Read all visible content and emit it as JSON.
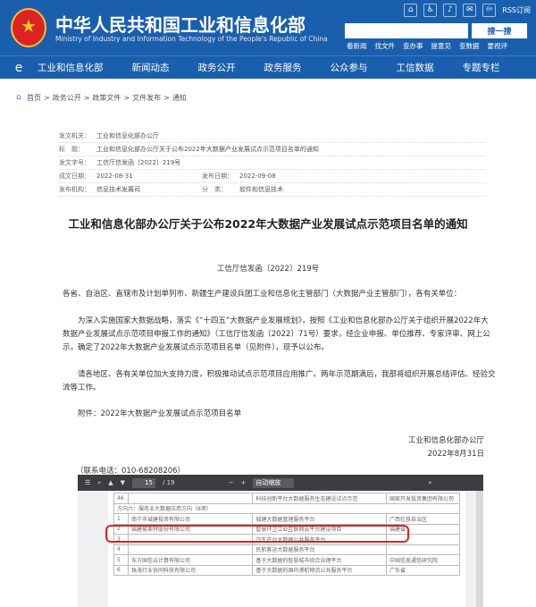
{
  "header": {
    "title": "中华人民共和国工业和信息化部",
    "subtitle": "Ministry of Industry and Information Technology of the People's Republic of China",
    "icon_labels": [
      "⌂",
      "♿",
      "♪",
      "✉",
      "♾"
    ],
    "rss": "RSS订阅",
    "search_placeholder": "",
    "search_button": "搜一搜",
    "quick_links": [
      "看新闻",
      "找文件",
      "查办事",
      "提意见",
      "查数据",
      "要视评"
    ]
  },
  "nav": {
    "logo": "e",
    "items": [
      "工业和信息化部",
      "新闻动态",
      "政务公开",
      "政务服务",
      "公众参与",
      "工信数据",
      "专题专栏"
    ]
  },
  "breadcrumb": [
    "首页",
    "政务公开",
    "政策文件",
    "文件发布",
    "通知"
  ],
  "meta": {
    "org_label": "发文机关：",
    "org": "工业和信息化部办公厅",
    "title_label": "标　题：",
    "title": "工业和信息化部办公厅关于公布2022年大数据产业发展试点示范项目名单的通知",
    "docno_label": "发文字号：",
    "docno": "工信厅信发函〔2022〕219号",
    "date_label": "成文日期：",
    "date": "2022-08-31",
    "pub_label": "发布日期：",
    "pub": "2022-09-08",
    "unit_label": "发布机构：",
    "unit": "信息技术发展司",
    "cat_label": "分　类：",
    "cat": "软件和信息技术"
  },
  "article": {
    "title": "工业和信息化部办公厅关于公布2022年大数据产业发展试点示范项目名单的通知",
    "doc_no": "工信厅信发函〔2022〕219号",
    "salutation": "各省、自治区、直辖市及计划单列市、新疆生产建设兵团工业和信息化主管部门（大数据产业主管部门），各有关单位：",
    "p1_l1": "为深入实施国家大数据战略，落实《“十四五”大数据产业发展规划》，按照《工业和信息化部办公厅关于组织开展2022年大",
    "p1_l2": "数据产业发展试点示范项目申报工作的通知》（工信厅信发函〔2022〕71号）要求，经企业申报、单位推荐、专家评审、网上公",
    "p1_l3": "示，确定了2022年大数据产业发展试点示范项目名单（见附件），现予以公布。",
    "p2_l1": "请各地区、各有关单位加大支持力度，积极推动试点示范项目应用推广。两年示范期满后，我部将组织开展总结评估、经验交",
    "p2_l2": "流等工作。",
    "attachment": "附件：2022年大数据产业发展试点示范项目名单",
    "signer": "工业和信息化部办公厅",
    "sign_date": "2022年8月31日",
    "contact": "（联系电话：010-68208206）"
  },
  "pdf": {
    "page_current": "15",
    "page_total": "/ 19",
    "zoom": "自动缩放",
    "rows": [
      [
        "46",
        "",
        "科技创新平台大数据服务生态建设试点示范",
        "国家开发投资集团有限公司"
      ],
      [
        "方向六：服务业大数据应用方向（8项）",
        "",
        "",
        ""
      ],
      [
        "1",
        "南宁市城建投资有限公司",
        "城建大数据管理服务平台",
        "广西壮族自治区"
      ],
      [
        "2",
        "福建易美特股份有限公司",
        "智慧环卫工业互联网云平台建设项目",
        "福建省"
      ],
      [
        "3",
        "",
        "汽车产业大数据公共服务平台",
        ""
      ],
      [
        "4",
        "",
        "民航客运大数据服务平台",
        ""
      ],
      [
        "5",
        "东方国信云计算有限公司",
        "基于大数据的智慧城市综合治理平台",
        "中国信息通信研究院"
      ],
      [
        "6",
        "珠海行业协同科技有限公司",
        "基于大数据的国内港航物流公共服务平台",
        "广东省"
      ]
    ]
  }
}
